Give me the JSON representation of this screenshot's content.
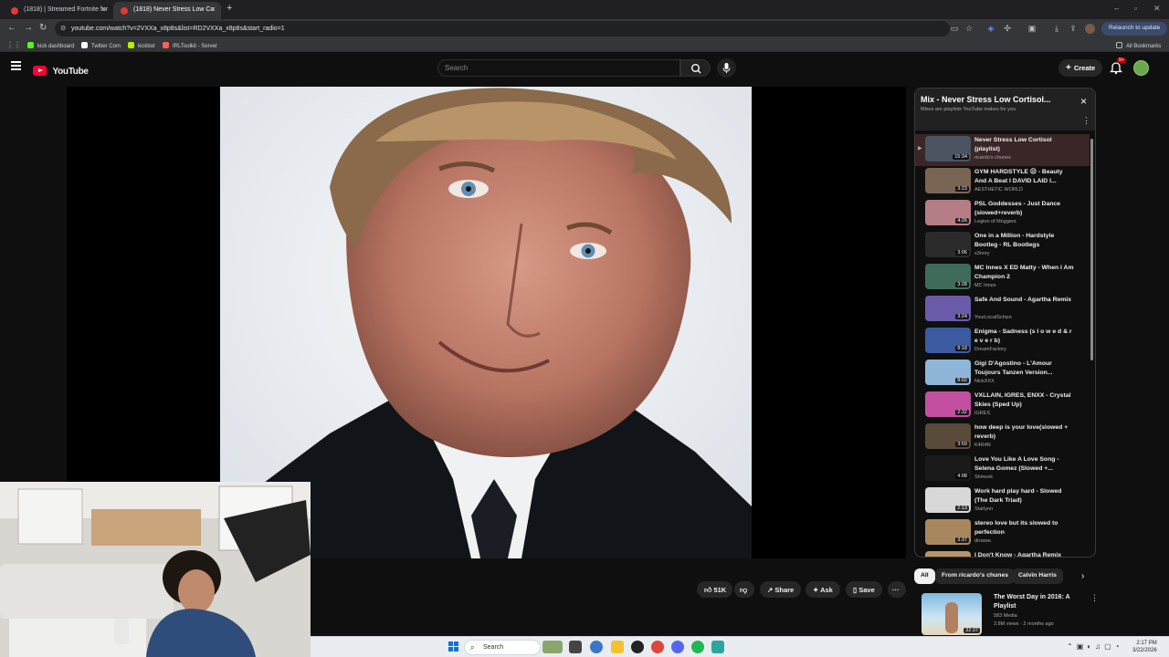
{
  "browser": {
    "tabs": [
      {
        "title": "(1818) | Streamed Fortnite for",
        "active": false
      },
      {
        "title": "(1818) Never Stress Low Co",
        "active": true
      }
    ],
    "url": "youtube.com/watch?v=2VXXa_x8p8s&list=RD2VXXa_x8p8s&start_radio=1",
    "relaunch_label": "Relaunch to update",
    "bookmarks": [
      {
        "label": "kick dashboard",
        "color": "#53fc18"
      },
      {
        "label": "Twitter Com",
        "color": "#ffffff"
      },
      {
        "label": "kickbot",
        "color": "#b6f000"
      },
      {
        "label": "IRLToolkit - Server",
        "color": "#ff5f5f"
      }
    ],
    "all_bookmarks_label": "All Bookmarks"
  },
  "youtube": {
    "logo_text": "YouTube",
    "search_placeholder": "Search",
    "create_label": "Create",
    "notif_count": "9+"
  },
  "actions": {
    "like_count": "51K",
    "share_label": "Share",
    "ask_label": "Ask",
    "save_label": "Save"
  },
  "playlist": {
    "title": "Mix - Never Stress Low Cortisol...",
    "subtitle": "Mixes are playlists YouTube makes for you",
    "items": [
      {
        "title": "Never Stress Low Cortisol (playlist)",
        "channel": "ricardo's chunes",
        "duration": "15:34",
        "current": true,
        "color": "#4a5463"
      },
      {
        "title": "GYM HARDSTYLE ☹ - Beauty And A Beat I DAVID LAID I...",
        "channel": "AESTHETIC WORLD",
        "duration": "3:23",
        "current": false,
        "color": "#7a6555"
      },
      {
        "title": "PSL Goddesses - Just Dance (slowed+reverb)",
        "channel": "Legion of Moggers",
        "duration": "4:26",
        "current": false,
        "color": "#b57d86"
      },
      {
        "title": "One in a Million - Hardstyle Bootleg - RL Bootlegs",
        "channel": "s3nnry",
        "duration": "3:06",
        "current": false,
        "color": "#2b2b2b"
      },
      {
        "title": "MC Innes X ED Matty - When I Am Champion 2",
        "channel": "MC Innes",
        "duration": "3:28",
        "current": false,
        "color": "#3f6b5a"
      },
      {
        "title": "Safe And Sound - Agartha Remix",
        "channel": "YourLocalSchizo",
        "duration": "3:24",
        "current": false,
        "color": "#6a5aa8"
      },
      {
        "title": "Enigma - Sadness (s l o w e d & r e v e r b)",
        "channel": "DreamFactory",
        "duration": "8:18",
        "current": false,
        "color": "#3c5aa0"
      },
      {
        "title": "Gigi D'Agostino - L'Amour Toujours Tanzen Version...",
        "channel": "NickXXX",
        "duration": "8:02",
        "current": false,
        "color": "#8fb6d8"
      },
      {
        "title": "VXLLAIN, IGRES, ENXX - Crystal Skies (Sped Up)",
        "channel": "IGRES",
        "duration": "2:32",
        "current": false,
        "color": "#c24fa0"
      },
      {
        "title": "how deep is your love(slowed + reverb)",
        "channel": "K4R4N",
        "duration": "3:59",
        "current": false,
        "color": "#5a4a3a"
      },
      {
        "title": "Love You Like A Love Song - Selena Gomez (Slowed +...",
        "channel": "Shmunk",
        "duration": "4:08",
        "current": false,
        "color": "#1a1a1a"
      },
      {
        "title": "Work hard play hard - Slowed (The Dark Triad)",
        "channel": "Starlynn",
        "duration": "2:13",
        "current": false,
        "color": "#d8d8d8"
      },
      {
        "title": "stereo love but its slowed to perfection",
        "channel": "drowse.",
        "duration": "3:37",
        "current": false,
        "color": "#a8875e"
      },
      {
        "title": "I Don't Know - Agartha Remix",
        "channel": "",
        "duration": "",
        "current": false,
        "color": "#b8946a"
      }
    ]
  },
  "chips": [
    "All",
    "From ricardo's chunes",
    "Calvin Harris"
  ],
  "recommended": {
    "title": "The Worst Day in 2016: A Playlist",
    "channel": "583 Media",
    "meta": "3.8M views · 2 months ago",
    "duration": "32:37"
  },
  "taskbar": {
    "search_label": "Search",
    "time": "2:17 PM",
    "date": "3/22/2026"
  }
}
